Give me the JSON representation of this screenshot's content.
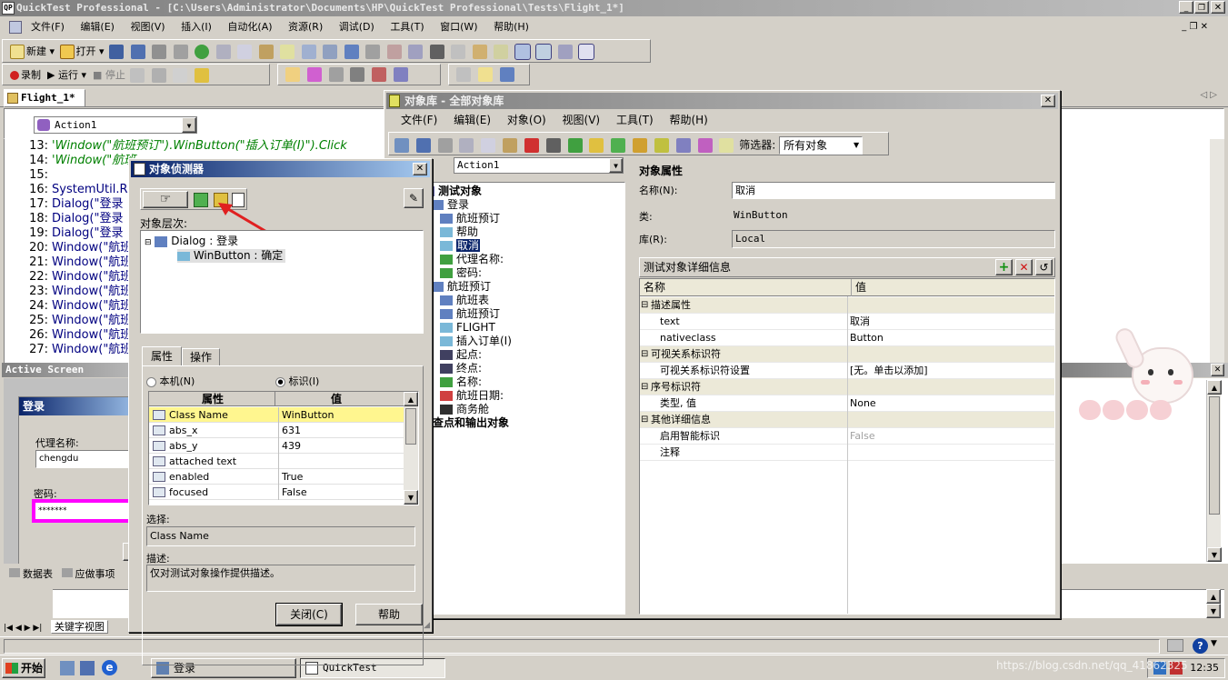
{
  "app": {
    "title": "QuickTest Professional - [C:\\Users\\Administrator\\Documents\\HP\\QuickTest Professional\\Tests\\Flight_1*]"
  },
  "menubar": {
    "items": [
      "文件(F)",
      "编辑(E)",
      "视图(V)",
      "插入(I)",
      "自动化(A)",
      "资源(R)",
      "调试(D)",
      "工具(T)",
      "窗口(W)",
      "帮助(H)"
    ]
  },
  "toolbar1": {
    "new_label": "新建",
    "open_label": "打开"
  },
  "toolbar2": {
    "record_label": "录制",
    "run_label": "运行",
    "stop_label": "停止"
  },
  "doc_tab": {
    "label": "Flight_1*"
  },
  "action_dropdown": {
    "value": "Action1"
  },
  "code": {
    "lines": [
      {
        "n": "13:",
        "t": "'Window(\"航班预订\").WinButton(\"插入订单(I)\").Click",
        "cls": "comment"
      },
      {
        "n": "14:",
        "t": "'Window(\"航班",
        "cls": "comment"
      },
      {
        "n": "15:",
        "t": "",
        "cls": ""
      },
      {
        "n": "16:",
        "t": "SystemUtil.R",
        "cls": "code"
      },
      {
        "n": "17:",
        "t": "Dialog(\"登录",
        "cls": "code"
      },
      {
        "n": "18:",
        "t": "Dialog(\"登录",
        "cls": "code"
      },
      {
        "n": "19:",
        "t": "Dialog(\"登录",
        "cls": "code"
      },
      {
        "n": "20:",
        "t": "Window(\"航班",
        "cls": "code"
      },
      {
        "n": "21:",
        "t": "Window(\"航班",
        "cls": "code"
      },
      {
        "n": "22:",
        "t": "Window(\"航班",
        "cls": "code"
      },
      {
        "n": "23:",
        "t": "Window(\"航班",
        "cls": "code"
      },
      {
        "n": "24:",
        "t": "Window(\"航班",
        "cls": "code"
      },
      {
        "n": "25:",
        "t": "Window(\"航班",
        "cls": "code"
      },
      {
        "n": "26:",
        "t": "Window(\"航班",
        "cls": "code"
      },
      {
        "n": "27:",
        "t": "Window(\"航班",
        "cls": "code"
      }
    ]
  },
  "active_screen": {
    "title": "Active Screen",
    "login_title": "登录",
    "agent_label": "代理名称:",
    "agent_value": "chengdu",
    "password_label": "密码:",
    "password_value": "*******"
  },
  "bottom_tabs": {
    "data_table": "数据表",
    "todo": "应做事项",
    "keyword_view": "关键字视图"
  },
  "spy": {
    "title": "对象侦测器",
    "hierarchy_label": "对象层次:",
    "tree": [
      {
        "label": "Dialog : 登录"
      },
      {
        "label": "WinButton : 确定"
      }
    ],
    "tabs": {
      "properties": "属性",
      "operations": "操作"
    },
    "radio_native": "本机(N)",
    "radio_identify": "标识(I)",
    "grid_headers": {
      "prop": "属性",
      "val": "值"
    },
    "rows": [
      {
        "p": "Class Name",
        "v": "WinButton"
      },
      {
        "p": "abs_x",
        "v": "631"
      },
      {
        "p": "abs_y",
        "v": "439"
      },
      {
        "p": "attached text",
        "v": ""
      },
      {
        "p": "enabled",
        "v": "True"
      },
      {
        "p": "focused",
        "v": "False"
      }
    ],
    "selection_label": "选择:",
    "selection_value": "Class Name",
    "desc_label": "描述:",
    "desc_value": "仅对测试对象操作提供描述。",
    "close_button": "关闭(C)",
    "help_button": "帮助"
  },
  "repo": {
    "title": "对象库 - 全部对象库",
    "menu": [
      "文件(F)",
      "编辑(E)",
      "对象(O)",
      "视图(V)",
      "工具(T)",
      "帮助(H)"
    ],
    "filter_label": "筛选器:",
    "filter_value": "所有对象",
    "action_value": "Action1",
    "tree": [
      {
        "label": "测试对象",
        "bold": true
      },
      {
        "label": "登录",
        "bold": false
      },
      {
        "label": "航班预订",
        "bold": false
      },
      {
        "label": "帮助",
        "bold": false
      },
      {
        "label": "取消",
        "bold": false
      },
      {
        "label": "代理名称:",
        "bold": false
      },
      {
        "label": "密码:",
        "bold": false
      },
      {
        "label": "航班预订",
        "bold": false
      },
      {
        "label": "航班表",
        "bold": false
      },
      {
        "label": "航班预订",
        "bold": false
      },
      {
        "label": "FLIGHT",
        "bold": false
      },
      {
        "label": "插入订单(I)",
        "bold": false
      },
      {
        "label": "起点:",
        "bold": false
      },
      {
        "label": "终点:",
        "bold": false
      },
      {
        "label": "名称:",
        "bold": false
      },
      {
        "label": "航班日期:",
        "bold": false
      },
      {
        "label": "商务舱",
        "bold": false
      },
      {
        "label": "检查点和输出对象",
        "bold": true
      }
    ],
    "props_header": "对象属性",
    "name_label": "名称(N):",
    "name_value": "取消",
    "class_label": "类:",
    "class_value": "WinButton",
    "lib_label": "库(R):",
    "lib_value": "Local",
    "details_header": "测试对象详细信息",
    "grid_headers": {
      "name": "名称",
      "value": "值"
    },
    "grid_rows": [
      {
        "n": "描述属性",
        "v": "",
        "group": true
      },
      {
        "n": "text",
        "v": "取消",
        "group": false
      },
      {
        "n": "nativeclass",
        "v": "Button",
        "group": false
      },
      {
        "n": "可视关系标识符",
        "v": "",
        "group": true
      },
      {
        "n": "可视关系标识符设置",
        "v": "[无。单击以添加]",
        "group": false
      },
      {
        "n": "序号标识符",
        "v": "",
        "group": true
      },
      {
        "n": "类型, 值",
        "v": "None",
        "group": false
      },
      {
        "n": "其他详细信息",
        "v": "",
        "group": true
      },
      {
        "n": "启用智能标识",
        "v": "False",
        "group": false,
        "gray": true
      },
      {
        "n": "注释",
        "v": "",
        "group": false
      }
    ]
  },
  "taskbar": {
    "start": "开始",
    "task1": "登录",
    "task2": "QuickTest Professio...",
    "clock": "12:35",
    "watermark": "https://blog.csdn.net/qq_41862325"
  }
}
